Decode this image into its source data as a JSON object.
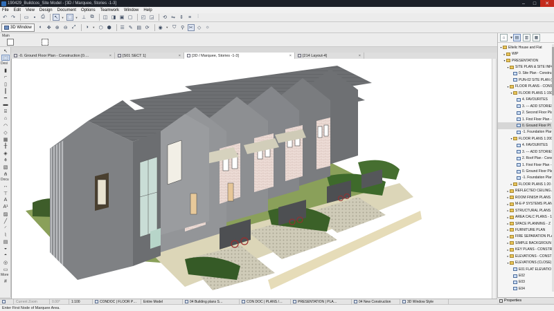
{
  "window": {
    "title": "190429_Buildcos_Site Model - [3D / Marquee, Stories -1-3]",
    "minimize_glyph": "–",
    "maximize_glyph": "□",
    "close_glyph": "✕"
  },
  "menu": [
    "File",
    "Edit",
    "View",
    "Design",
    "Document",
    "Options",
    "Teamwork",
    "Window",
    "Help"
  ],
  "toolbar": {
    "view_mode_label": "3D Window"
  },
  "infobox": {
    "main_label": "Main"
  },
  "toolbox": {
    "sections": [
      "Desi",
      "Docu",
      "More"
    ]
  },
  "tabs": [
    {
      "label": "-0. Ground Floor Plan - Construction [0.…",
      "active": false
    },
    {
      "label": "[S01 SECT 1]",
      "active": false
    },
    {
      "label": "[3D / Marquee, Stories -1-3]",
      "active": true
    },
    {
      "label": "[214 Layout-4]",
      "active": false
    }
  ],
  "navigator": {
    "tree": [
      {
        "indent": 0,
        "twisty": "▾",
        "icon": "folder",
        "label": "Eltelic House and Flat",
        "selected": false
      },
      {
        "indent": 1,
        "twisty": "▸",
        "icon": "folder",
        "label": "WIP",
        "selected": false
      },
      {
        "indent": 1,
        "twisty": "▾",
        "icon": "folder",
        "label": "PRESENTATION",
        "selected": false
      },
      {
        "indent": 2,
        "twisty": "▾",
        "icon": "folder",
        "label": "SITE PLAN & SITE INFO",
        "selected": false
      },
      {
        "indent": 3,
        "twisty": "",
        "icon": "view",
        "label": "0. Site Plan - Constru",
        "selected": false
      },
      {
        "indent": 3,
        "twisty": "",
        "icon": "view",
        "label": "PUN-02 SITE PLAN (W)",
        "selected": false
      },
      {
        "indent": 2,
        "twisty": "▾",
        "icon": "folder",
        "label": "FLOOR PLANS - CONSTI",
        "selected": false
      },
      {
        "indent": 3,
        "twisty": "▾",
        "icon": "folder",
        "label": "FLOOR PLANS 1:150 (",
        "selected": false
      },
      {
        "indent": 4,
        "twisty": "",
        "icon": "view",
        "label": "4. FAVOURITES",
        "selected": false
      },
      {
        "indent": 4,
        "twisty": "",
        "icon": "view",
        "label": "3. --- ADD STORIES",
        "selected": false
      },
      {
        "indent": 4,
        "twisty": "",
        "icon": "view",
        "label": "2. Second Floor Pla",
        "selected": false
      },
      {
        "indent": 4,
        "twisty": "",
        "icon": "view",
        "label": "1. First Floor Plan -",
        "selected": false
      },
      {
        "indent": 4,
        "twisty": "",
        "icon": "view",
        "label": "0. Ground Floor Pl",
        "selected": true
      },
      {
        "indent": 4,
        "twisty": "",
        "icon": "view",
        "label": "-1. Foundation Plar",
        "selected": false
      },
      {
        "indent": 3,
        "twisty": "▾",
        "icon": "folder",
        "label": "FLOOR PLANS 1:200 (",
        "selected": false
      },
      {
        "indent": 4,
        "twisty": "",
        "icon": "view",
        "label": "4. FAVOURITES",
        "selected": false
      },
      {
        "indent": 4,
        "twisty": "",
        "icon": "view",
        "label": "3. --- ADD STORIES",
        "selected": false
      },
      {
        "indent": 4,
        "twisty": "",
        "icon": "view",
        "label": "2. Roof Plan - Cons",
        "selected": false
      },
      {
        "indent": 4,
        "twisty": "",
        "icon": "view",
        "label": "1. First Floor Plan -",
        "selected": false
      },
      {
        "indent": 4,
        "twisty": "",
        "icon": "view",
        "label": "0. Ground Floor Pla",
        "selected": false
      },
      {
        "indent": 4,
        "twisty": "",
        "icon": "view",
        "label": "-1. Foundation Plar",
        "selected": false
      },
      {
        "indent": 3,
        "twisty": "▸",
        "icon": "folder",
        "label": "FLOOR PLANS 1:20 (F",
        "selected": false
      },
      {
        "indent": 2,
        "twisty": "▸",
        "icon": "folder",
        "label": "REFLECTED CEILING /",
        "selected": false
      },
      {
        "indent": 2,
        "twisty": "▸",
        "icon": "folder",
        "label": "ROOM FINISH PLANS",
        "selected": false
      },
      {
        "indent": 2,
        "twisty": "▸",
        "icon": "folder",
        "label": "M-E-P SYSTEMS PLAN",
        "selected": false
      },
      {
        "indent": 2,
        "twisty": "▸",
        "icon": "folder",
        "label": "STRUCTURAL PLANS (",
        "selected": false
      },
      {
        "indent": 2,
        "twisty": "▸",
        "icon": "folder",
        "label": "AREA CALC PLANS - 1",
        "selected": false
      },
      {
        "indent": 2,
        "twisty": "▸",
        "icon": "folder",
        "label": "SPACE PLANNING - Z",
        "selected": false
      },
      {
        "indent": 2,
        "twisty": "▸",
        "icon": "folder",
        "label": "FURNITURE PLAN",
        "selected": false
      },
      {
        "indent": 2,
        "twisty": "▸",
        "icon": "folder",
        "label": "FIRE SEPARATION PLA",
        "selected": false
      },
      {
        "indent": 2,
        "twisty": "▸",
        "icon": "folder",
        "label": "SIMPLE BACKGROUN",
        "selected": false
      },
      {
        "indent": 2,
        "twisty": "▸",
        "icon": "folder",
        "label": "KEY PLANS - CONSTRI",
        "selected": false
      },
      {
        "indent": 2,
        "twisty": "▸",
        "icon": "folder",
        "label": "ELEVATIONS - CONSTR",
        "selected": false
      },
      {
        "indent": 2,
        "twisty": "▾",
        "icon": "folder",
        "label": "ELEVATIONS (CLOSE)",
        "selected": false
      },
      {
        "indent": 3,
        "twisty": "",
        "icon": "view",
        "label": "E01 FLAT ELEVATIO",
        "selected": false
      },
      {
        "indent": 3,
        "twisty": "",
        "icon": "view",
        "label": "E02",
        "selected": false
      },
      {
        "indent": 3,
        "twisty": "",
        "icon": "view",
        "label": "E03",
        "selected": false
      },
      {
        "indent": 3,
        "twisty": "",
        "icon": "view",
        "label": "E04",
        "selected": false
      }
    ],
    "properties_label": "Properties"
  },
  "quickbar": [
    {
      "label": "Current Zoom",
      "muted": true,
      "icon": false
    },
    {
      "label": "0.00°",
      "muted": true,
      "icon": false
    },
    {
      "label": "1:100",
      "muted": false,
      "icon": false
    },
    {
      "label": "CONDOC | FLOOR P…",
      "muted": false,
      "icon": true
    },
    {
      "label": "Entire Model",
      "muted": false,
      "icon": false
    },
    {
      "label": "04 Building plans S…",
      "muted": false,
      "icon": true
    },
    {
      "label": "CON DOC | PLANS /…",
      "muted": false,
      "icon": true
    },
    {
      "label": "PRESENTATION | PLA…",
      "muted": false,
      "icon": true
    },
    {
      "label": "04 New Construction",
      "muted": false,
      "icon": true
    },
    {
      "label": "3D Window Style",
      "muted": false,
      "icon": true
    }
  ],
  "status": {
    "hint": "Enter First Node of Marquee Area."
  }
}
